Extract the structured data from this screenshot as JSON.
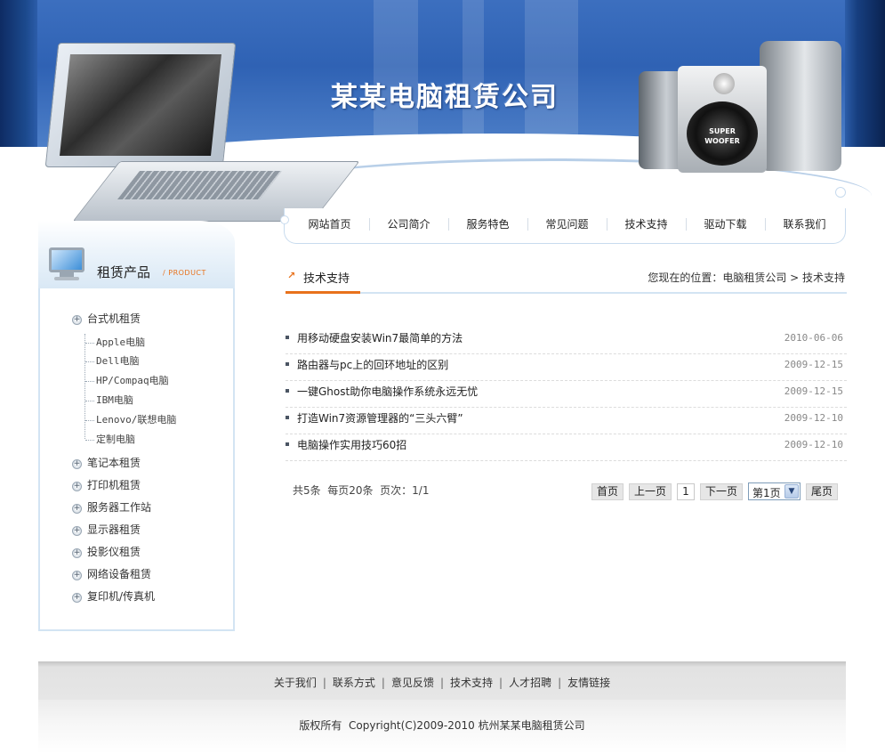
{
  "site": {
    "title": "某某电脑租赁公司"
  },
  "banner": {
    "woofer_label": "SUPER WOOFER"
  },
  "nav": {
    "items": [
      "网站首页",
      "公司简介",
      "服务特色",
      "常见问题",
      "技术支持",
      "驱动下载",
      "联系我们"
    ]
  },
  "sidebar": {
    "title": "租赁产品",
    "subtitle": "/ PRODUCT",
    "categories": [
      {
        "label": "台式机租赁",
        "children": [
          "Apple电脑",
          "Dell电脑",
          "HP/Compaq电脑",
          "IBM电脑",
          "Lenovo/联想电脑",
          "定制电脑"
        ]
      },
      {
        "label": "笔记本租赁"
      },
      {
        "label": "打印机租赁"
      },
      {
        "label": "服务器工作站"
      },
      {
        "label": "显示器租赁"
      },
      {
        "label": "投影仪租赁"
      },
      {
        "label": "网络设备租赁"
      },
      {
        "label": "复印机/传真机"
      }
    ]
  },
  "main": {
    "section_title": "技术支持",
    "location": "您现在的位置：电脑租赁公司 > 技术支持",
    "articles": [
      {
        "title": "用移动硬盘安装Win7最简单的方法",
        "date": "2010-06-06"
      },
      {
        "title": "路由器与pc上的回环地址的区别",
        "date": "2009-12-15"
      },
      {
        "title": "一键Ghost助你电脑操作系统永远无忧",
        "date": "2009-12-15"
      },
      {
        "title": "打造Win7资源管理器的“三头六臂”",
        "date": "2009-12-10"
      },
      {
        "title": "电脑操作实用技巧60招",
        "date": "2009-12-10"
      }
    ],
    "pagination": {
      "info": "共5条  每页20条  页次：1/1",
      "first": "首页",
      "prev": "上一页",
      "current": "1",
      "next": "下一页",
      "select_value": "第1页",
      "last": "尾页"
    }
  },
  "footer": {
    "links": [
      "关于我们",
      "联系方式",
      "意见反馈",
      "技术支持",
      "人才招聘",
      "友情链接"
    ],
    "copyright": "版权所有  Copyright(C)2009-2010 杭州某某电脑租赁公司"
  },
  "colors": {
    "accent": "#e8721c",
    "brand_blue": "#2f62b4",
    "border_blue": "#d3e4f3"
  }
}
